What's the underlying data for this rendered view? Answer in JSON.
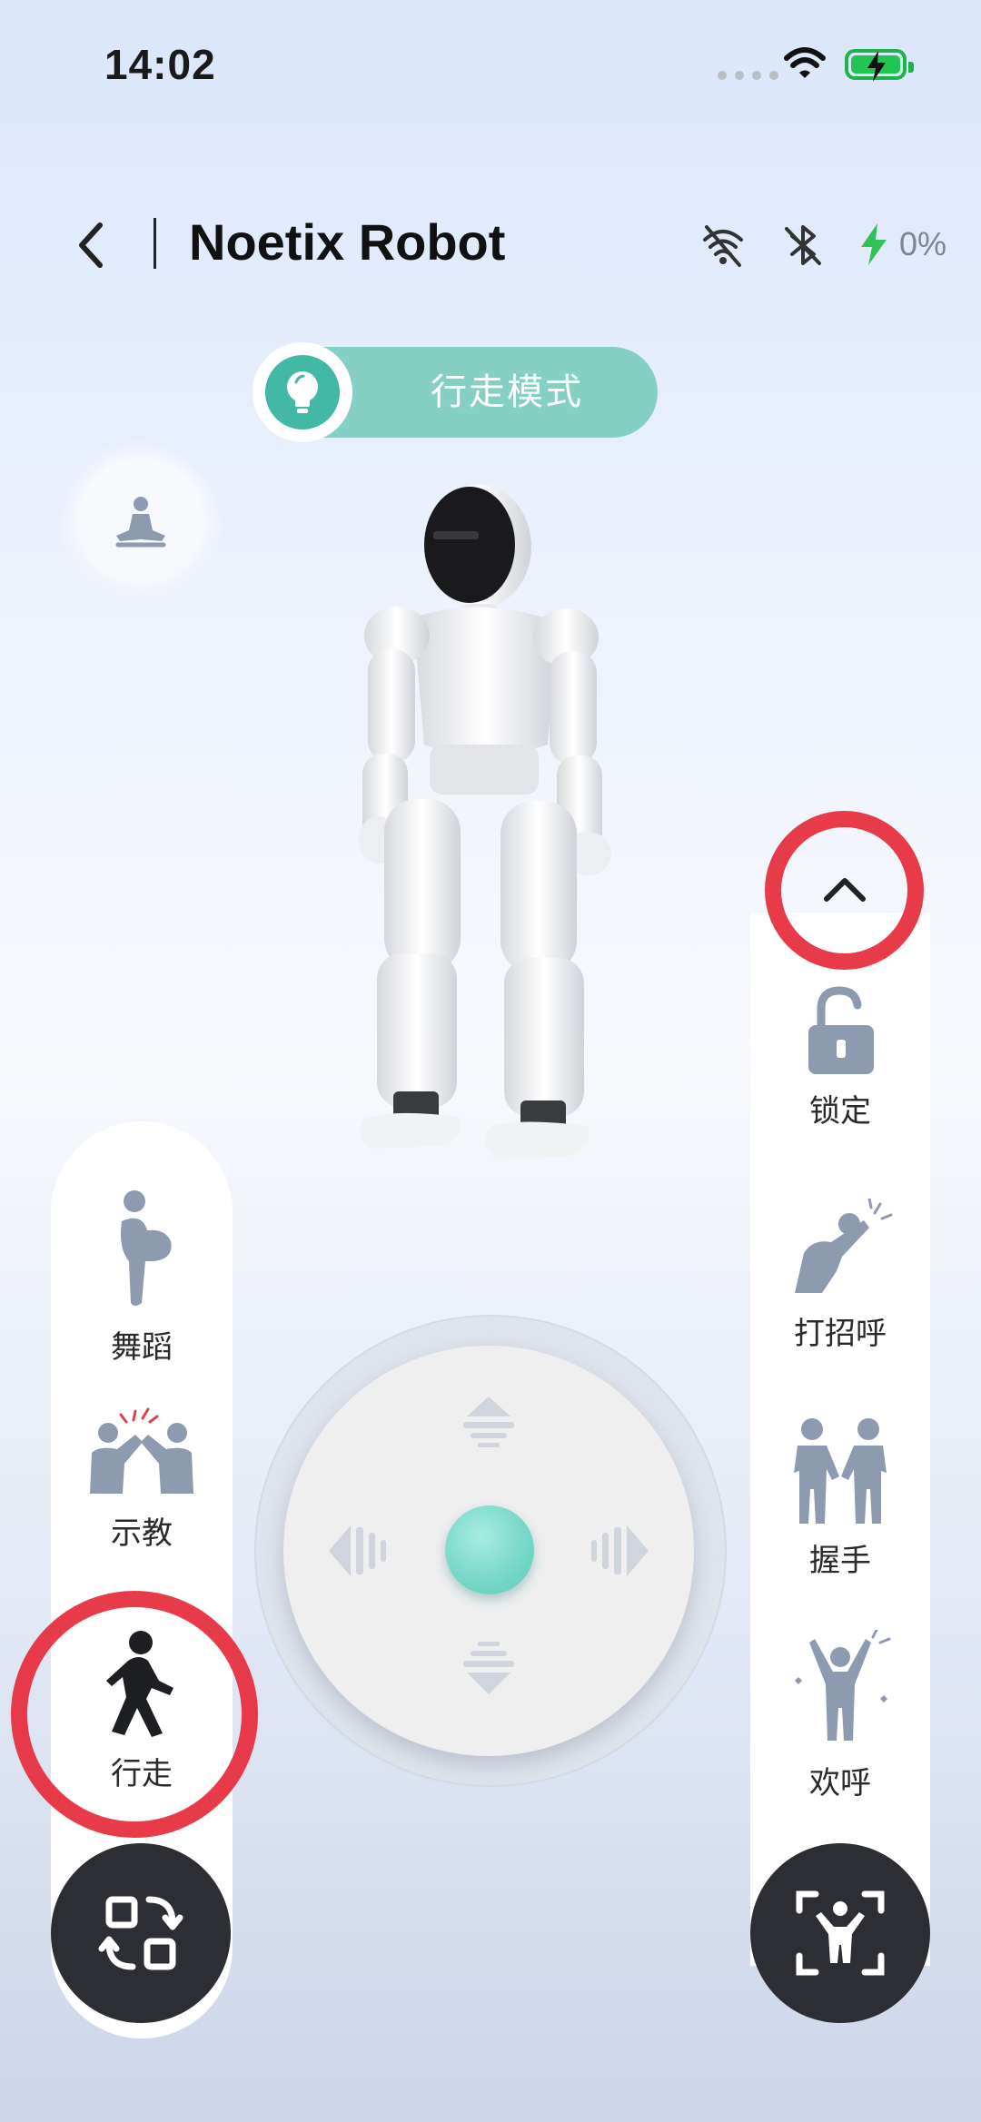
{
  "status_bar": {
    "time": "14:02"
  },
  "header": {
    "title": "Noetix Robot",
    "battery_percent": "0%"
  },
  "mode": {
    "label": "行走模式"
  },
  "left_menu": [
    {
      "label": "舞蹈",
      "icon": "dance-icon"
    },
    {
      "label": "示教",
      "icon": "teach-icon"
    },
    {
      "label": "行走",
      "icon": "walk-icon"
    }
  ],
  "right_menu": [
    {
      "label": "锁定",
      "icon": "lock-icon"
    },
    {
      "label": "打招呼",
      "icon": "wave-icon"
    },
    {
      "label": "握手",
      "icon": "handshake-icon"
    },
    {
      "label": "欢呼",
      "icon": "cheer-icon"
    }
  ],
  "colors": {
    "accent": "#43b8a4",
    "pill": "#86cfc3",
    "icon_gray": "#8e9ab0",
    "highlight": "#e62a3b",
    "dark": "#2c2e33"
  }
}
